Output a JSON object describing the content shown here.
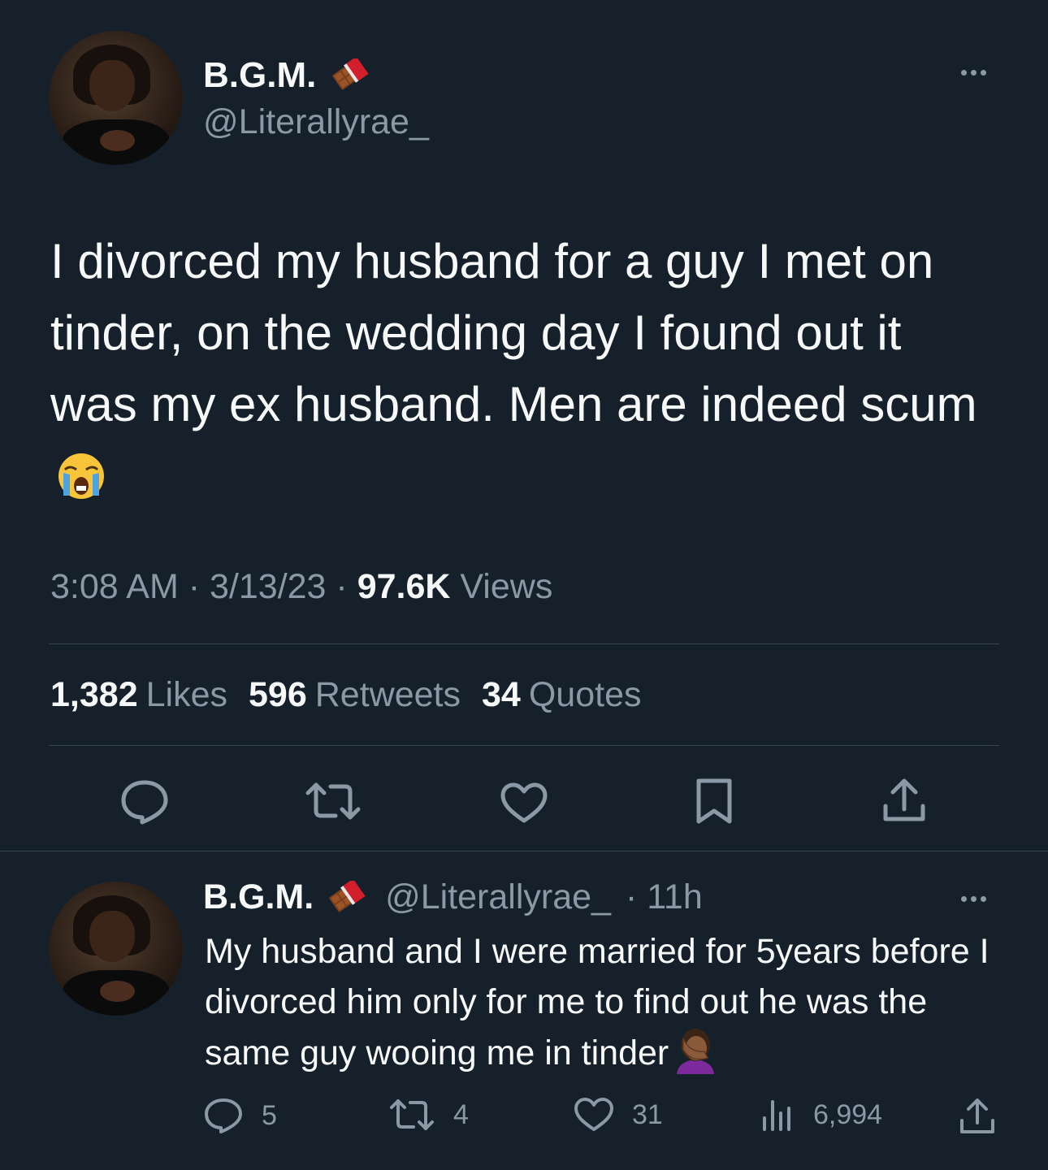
{
  "tweet": {
    "author_name": "B.G.M.",
    "author_handle": "@Literallyrae_",
    "text": "I divorced my husband for a guy I met on tinder, on the wedding day I found out it was my ex husband. Men are indeed scum",
    "time": "3:08 AM",
    "separator": "·",
    "date": "3/13/23",
    "views_count": "97.6K",
    "views_label": "Views",
    "likes_count": "1,382",
    "likes_label": "Likes",
    "retweets_count": "596",
    "retweets_label": "Retweets",
    "quotes_count": "34",
    "quotes_label": "Quotes"
  },
  "reply": {
    "author_name": "B.G.M.",
    "author_handle": "@Literallyrae_",
    "time_ago": "· 11h",
    "text": "My husband and I were married for 5years before I divorced him only for me to find out he was the same guy wooing me in tinder",
    "replies": "5",
    "retweets": "4",
    "likes": "31",
    "views": "6,994"
  },
  "icons": {
    "badge": "chocolate-bar-icon",
    "reply": "reply-icon",
    "retweet": "retweet-icon",
    "like": "heart-icon",
    "bookmark": "bookmark-icon",
    "share": "share-icon",
    "views": "analytics-icon",
    "more": "more-icon",
    "emoji_main": "loudly-crying-face-icon",
    "emoji_reply": "facepalm-icon"
  },
  "colors": {
    "background": "#15202b",
    "text": "#f7f9f9",
    "secondary": "#8b98a5",
    "divider": "#38444d"
  }
}
